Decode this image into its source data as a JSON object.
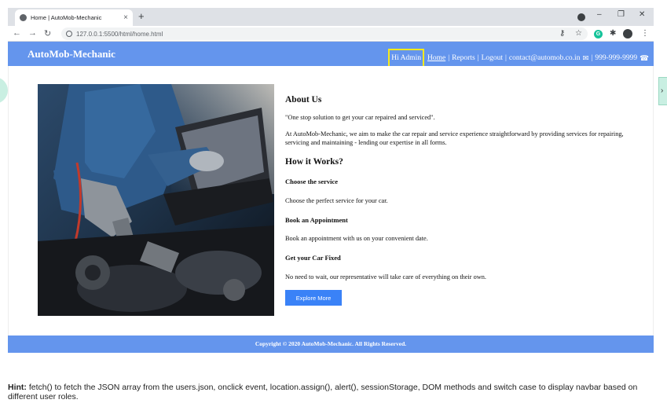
{
  "browser": {
    "tab_title": "Home | AutoMob-Mechanic",
    "tab_close": "×",
    "new_tab": "+",
    "url": "127.0.0.1:5500/html/home.html",
    "controls": {
      "minimize": "–",
      "restore": "❐",
      "close": "✕"
    }
  },
  "navbar": {
    "brand": "AutoMob-Mechanic",
    "greeting": "Hi Admin",
    "home": "Home",
    "reports": "Reports",
    "logout": "Logout",
    "email": "contact@automob.co.in",
    "phone": "999-999-9999",
    "separator": "|"
  },
  "content": {
    "about_title": "About Us",
    "quote": "\"One stop solution to get your car repaired and serviced\".",
    "about_text": "At AutoMob-Mechanic, we aim to make the car repair and service experience straightforward by providing services for repairing, servicing and maintaining - lending our expertise in all forms.",
    "how_title": "How it Works?",
    "steps": [
      {
        "title": "Choose the service",
        "text": "Choose the perfect service for your car."
      },
      {
        "title": "Book an Appointment",
        "text": "Book an appointment with us on your convenient date."
      },
      {
        "title": "Get your Car Fixed",
        "text": "No need to wait, our representative will take care of everything on their own."
      }
    ],
    "button": "Explore More"
  },
  "footer": {
    "copyright": "Copyright © 2020 AutoMob-Mechanic. All Rights Reserved."
  },
  "hint": {
    "label": "Hint:",
    "text": "fetch() to fetch the JSON array from the users.json, onclick event, location.assign(), alert(), sessionStorage, DOM methods and switch case to display navbar based on different user roles."
  },
  "colors": {
    "navbar": "#6495ed",
    "highlight": "#f7ea1b",
    "button": "#3a82f7"
  }
}
